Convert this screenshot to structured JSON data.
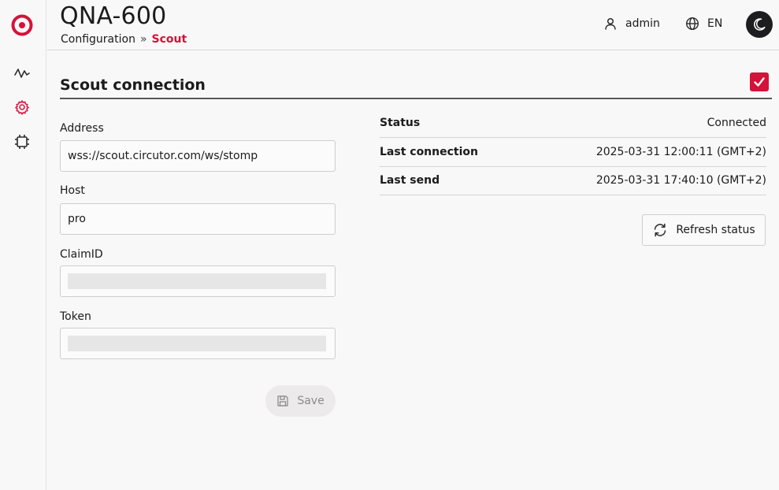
{
  "app": {
    "title": "QNA-600",
    "breadcrumb": {
      "parent": "Configuration",
      "separator": "»",
      "current": "Scout"
    }
  },
  "header": {
    "user": {
      "icon": "user-icon",
      "label": "admin"
    },
    "language": {
      "icon": "globe-icon",
      "label": "EN"
    },
    "theme_toggle": {
      "icon": "moon-icon"
    }
  },
  "sidebar": {
    "items": [
      {
        "name": "monitoring",
        "icon": "activity-icon"
      },
      {
        "name": "configuration",
        "icon": "gear-icon",
        "active": true
      },
      {
        "name": "device",
        "icon": "chip-icon"
      }
    ]
  },
  "section": {
    "title": "Scout connection",
    "enabled": true
  },
  "form": {
    "address": {
      "label": "Address",
      "value": "wss://scout.circutor.com/ws/stomp"
    },
    "host": {
      "label": "Host",
      "value": "pro"
    },
    "claim_id": {
      "label": "ClaimID",
      "value": ""
    },
    "token": {
      "label": "Token",
      "value": ""
    },
    "save_label": "Save"
  },
  "status": {
    "rows": [
      {
        "key": "Status",
        "value": "Connected"
      },
      {
        "key": "Last connection",
        "value": "2025-03-31 12:00:11 (GMT+2)"
      },
      {
        "key": "Last send",
        "value": "2025-03-31 17:40:10 (GMT+2)"
      }
    ],
    "refresh_label": "Refresh status"
  },
  "colors": {
    "accent": "#d4123a",
    "background": "#f9f8f8",
    "dark": "#1d1d1f"
  }
}
